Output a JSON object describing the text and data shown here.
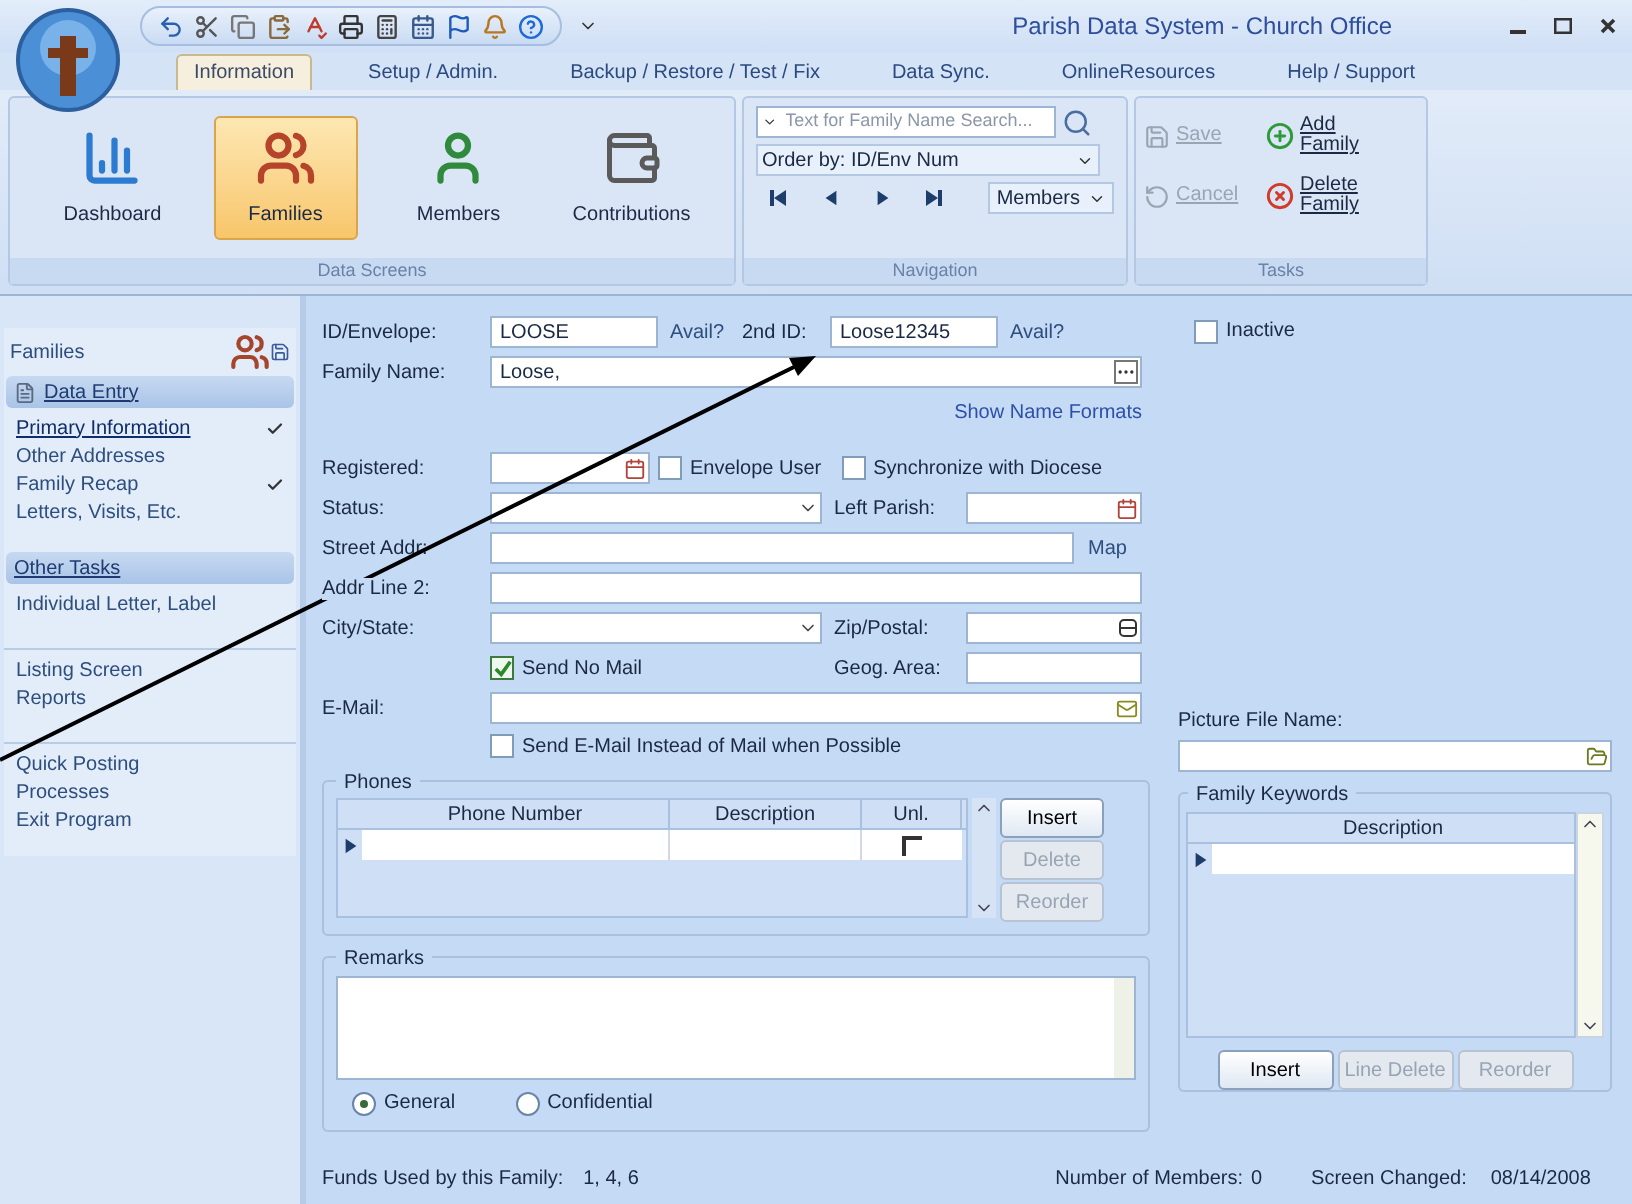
{
  "window": {
    "title": "Parish Data System - Church Office"
  },
  "ribbon_tabs": [
    {
      "label": "Information",
      "selected": true
    },
    {
      "label": "Setup / Admin.",
      "selected": false
    },
    {
      "label": "Backup / Restore / Test / Fix",
      "selected": false
    },
    {
      "label": "Data Sync.",
      "selected": false
    },
    {
      "label": "OnlineResources",
      "selected": false
    },
    {
      "label": "Help / Support",
      "selected": false
    }
  ],
  "data_screens": {
    "label": "Data Screens",
    "buttons": [
      {
        "kind": "dashboard",
        "label": "Dashboard",
        "selected": false
      },
      {
        "kind": "families",
        "label": "Families",
        "selected": true
      },
      {
        "kind": "members",
        "label": "Members",
        "selected": false
      },
      {
        "kind": "contributions",
        "label": "Contributions",
        "selected": false
      }
    ]
  },
  "navigation": {
    "label": "Navigation",
    "search_placeholder": "Text for Family Name Search...",
    "order_by": "Order by: ID/Env Num",
    "view": "Members"
  },
  "tasks": {
    "label": "Tasks",
    "buttons": [
      {
        "kind": "save",
        "label": "Save",
        "disabled": true
      },
      {
        "kind": "add",
        "label": "Add Family",
        "disabled": false
      },
      {
        "kind": "cancel",
        "label": "Cancel",
        "disabled": true
      },
      {
        "kind": "delete",
        "label": "Delete Family",
        "disabled": false
      }
    ]
  },
  "sidebar": {
    "title": "Families",
    "sections": [
      {
        "title": "Data Entry",
        "groups": [
          [
            {
              "label": "Primary Information",
              "selected": true,
              "checked": true
            },
            {
              "label": "Other Addresses",
              "selected": false,
              "checked": false
            },
            {
              "label": "Family Recap",
              "selected": false,
              "checked": true
            },
            {
              "label": "Letters, Visits, Etc.",
              "selected": false,
              "checked": false
            }
          ]
        ]
      },
      {
        "title": "Other Tasks",
        "groups": [
          [
            {
              "label": "Individual Letter, Label",
              "selected": false,
              "checked": false
            }
          ],
          [
            {
              "label": "Listing Screen",
              "selected": false,
              "checked": false
            },
            {
              "label": "Reports",
              "selected": false,
              "checked": false
            }
          ],
          [
            {
              "label": "Quick Posting",
              "selected": false,
              "checked": false
            },
            {
              "label": "Processes",
              "selected": false,
              "checked": false
            },
            {
              "label": "Exit Program",
              "selected": false,
              "checked": false
            }
          ]
        ]
      }
    ]
  },
  "form": {
    "id_label": "ID/Envelope:",
    "id_value": "LOOSE",
    "avail_1": "Avail?",
    "second_id_label": "2nd ID:",
    "second_id_value": "Loose12345",
    "avail_2": "Avail?",
    "inactive": {
      "label": "Inactive",
      "checked": false
    },
    "family_name_label": "Family Name:",
    "family_name_value": "Loose,",
    "show_name_formats": "Show Name Formats",
    "registered_label": "Registered:",
    "envelope_user": {
      "label": "Envelope User",
      "checked": false
    },
    "synchronize": {
      "label": "Synchronize with Diocese",
      "checked": false
    },
    "status_label": "Status:",
    "left_parish_label": "Left Parish:",
    "street_label": "Street Addr:",
    "map": "Map",
    "addr2_label": "Addr Line 2:",
    "city_label": "City/State:",
    "zip_label": "Zip/Postal:",
    "send_no_mail": {
      "label": "Send No Mail",
      "checked": true
    },
    "geog_label": "Geog. Area:",
    "email_label": "E-Mail:",
    "send_email": {
      "label": "Send E-Mail Instead of Mail when Possible",
      "checked": false
    }
  },
  "phones": {
    "title": "Phones",
    "columns": [
      "Phone Number",
      "Description",
      "Unl."
    ],
    "rows": [
      {
        "current": true,
        "unlisted": false
      }
    ],
    "buttons": [
      {
        "label": "Insert",
        "disabled": false
      },
      {
        "label": "Delete",
        "disabled": true
      },
      {
        "label": "Reorder",
        "disabled": true
      }
    ]
  },
  "remarks": {
    "title": "Remarks",
    "privacy": [
      {
        "label": "General",
        "selected": true
      },
      {
        "label": "Confidential",
        "selected": false
      }
    ]
  },
  "picture_file": {
    "label": "Picture File Name:"
  },
  "keywords": {
    "title": "Family Keywords",
    "columns": [
      "Description"
    ],
    "rows": [
      {
        "current": true
      }
    ],
    "buttons": [
      {
        "label": "Insert",
        "disabled": false
      },
      {
        "label": "Line Delete",
        "disabled": true
      },
      {
        "label": "Reorder",
        "disabled": true
      }
    ]
  },
  "footer": {
    "funds_label": "Funds Used by this Family:",
    "funds_value": "1, 4, 6",
    "members_label": "Number of Members:",
    "members_value": "0",
    "changed_label": "Screen Changed:",
    "changed_value": "08/14/2008"
  }
}
